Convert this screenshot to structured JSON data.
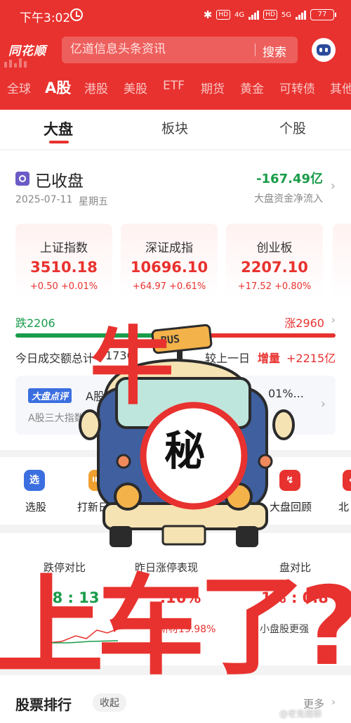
{
  "statusbar": {
    "time": "下午3:02",
    "bluetooth": "✱",
    "hd1": "HD",
    "net1": "4G",
    "hd2": "HD",
    "net2": "5G",
    "battery": "77"
  },
  "header": {
    "logo": "同花顺",
    "search_placeholder": "亿道信息头条资讯",
    "search_button": "搜索",
    "robot_icon": "robot-icon",
    "market_tabs": [
      "全球",
      "A股",
      "港股",
      "美股",
      "ETF",
      "期货",
      "黄金",
      "可转债",
      "其他"
    ],
    "active_market_tab": "A股"
  },
  "subtabs": {
    "items": [
      "大盘",
      "板块",
      "个股"
    ],
    "active": "大盘"
  },
  "market_status": {
    "title": "已收盘",
    "date": "2025-07-11",
    "weekday": "星期五",
    "net_flow": "-167.49亿",
    "net_flow_label": "大盘资金净流入"
  },
  "indices": [
    {
      "name": "上证指数",
      "value": "3510.18",
      "change": "+0.50  +0.01%"
    },
    {
      "name": "深证成指",
      "value": "10696.10",
      "change": "+64.97  +0.61%"
    },
    {
      "name": "创业板",
      "value": "2207.10",
      "change": "+17.52  +0.80%"
    }
  ],
  "breadth": {
    "down_label": "跌2206",
    "up_label": "涨2960",
    "down_fraction": 0.427
  },
  "turnover": {
    "label": "今日成交额总计",
    "value": "1736",
    "compare_label": "较上一日",
    "compare_tag": "增量",
    "compare_value": "+2215亿"
  },
  "comment": {
    "badge": "大盘点评",
    "title": "A股",
    "pct": "01%...",
    "subtitle": "A股三大指数今"
  },
  "shortcuts": [
    {
      "label": "选股",
      "icon_text": "选",
      "icon": "select-stock-icon",
      "color": "#3b6fe0"
    },
    {
      "label": "打新日",
      "icon_text": "IPO",
      "icon": "ipo-icon",
      "color": "#f0a030"
    },
    {
      "label": "大盘回顾",
      "icon_text": "↯",
      "icon": "market-review-icon",
      "color": "#e8322f"
    },
    {
      "label": "北",
      "icon_text": "↔",
      "icon": "northbound-icon",
      "color": "#e8322f"
    }
  ],
  "comparison": {
    "col1_title": "跌停对比",
    "col1_value": "68 : 13",
    "col2_title": "昨日涨停表现",
    "col2_value": ".16%",
    "col2_sub": "新材19.98%",
    "col3_title": "盘对比",
    "col3_value": "1% : 0.8",
    "col3_sub": "小盘股更强"
  },
  "ranking": {
    "title": "股票排行",
    "collapse": "收起",
    "more": "更多"
  },
  "overlay": {
    "ox": "牛",
    "mystery": "秘",
    "bus_sign": "BUS",
    "board": "上车了?"
  },
  "watermark": "@老鬼趣聊",
  "colors": {
    "brand_red": "#e8322f",
    "down_green": "#1a9c4a",
    "accent_blue": "#3b6fe0"
  }
}
